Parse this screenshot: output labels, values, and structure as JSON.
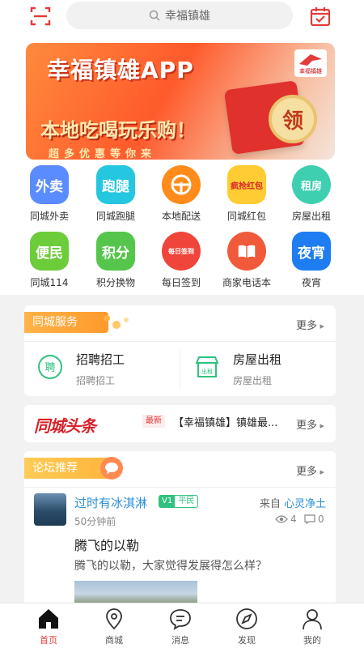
{
  "search": {
    "placeholder": "幸福镇雄"
  },
  "banner": {
    "title": "幸福镇雄APP",
    "subtitle": "本地吃喝玩乐购！",
    "tagline": "超多优惠等你来",
    "coin_text": "领",
    "logo_text": "幸福镇雄"
  },
  "grid": [
    {
      "icon_text": "外卖",
      "label": "同城外卖",
      "color": "#5b8cff"
    },
    {
      "icon_text": "跑腿",
      "label": "同城跑腿",
      "color": "#25c7e0"
    },
    {
      "icon_text": "",
      "label": "本地配送",
      "color": "#ff8c1a",
      "icon": "steering-wheel-icon"
    },
    {
      "icon_text": "疯抢红包",
      "label": "同城红包",
      "color": "#ffcc33",
      "icon": "red-packet-icon"
    },
    {
      "icon_text": "租房",
      "label": "房屋出租",
      "color": "#3ecfb0"
    },
    {
      "icon_text": "便民",
      "label": "同城114",
      "color": "#6dcc3a"
    },
    {
      "icon_text": "积分",
      "label": "积分换物",
      "color": "#55c64b"
    },
    {
      "icon_text": "每日签到",
      "label": "每日签到",
      "color": "#f0453a",
      "icon": "speedometer-icon"
    },
    {
      "icon_text": "",
      "label": "商家电话本",
      "color": "#f05a3a",
      "icon": "book-icon"
    },
    {
      "icon_text": "夜宵",
      "label": "夜宵",
      "color": "#1e7df0"
    }
  ],
  "services": {
    "tag": "同城服务",
    "more": "更多",
    "items": [
      {
        "title": "招聘招工",
        "sub": "招聘招工",
        "icon_text": "聘"
      },
      {
        "title": "房屋出租",
        "sub": "房屋出租",
        "icon_text": "出租"
      }
    ]
  },
  "news": {
    "logo": "同城头条",
    "badge": "最新",
    "text": "【幸福镇雄】镇雄最...",
    "more": "更多"
  },
  "forum": {
    "tag": "论坛推荐",
    "more": "更多",
    "post": {
      "author": "过时有冰淇淋",
      "level_v": "V1",
      "level": "平民",
      "time": "50分钟前",
      "from_label": "来自",
      "from_user": "心灵净土",
      "views": "4",
      "comments": "0",
      "title": "腾飞的以勒",
      "body": "腾飞的以勒，大家觉得发展得怎么样？"
    }
  },
  "nav": [
    {
      "label": "首页",
      "active": true
    },
    {
      "label": "商城",
      "active": false
    },
    {
      "label": "消息",
      "active": false
    },
    {
      "label": "发现",
      "active": false
    },
    {
      "label": "我的",
      "active": false
    }
  ],
  "colors": {
    "brand_red": "#e23b3b",
    "link_blue": "#2a8fd6",
    "level_green": "#2ec27e"
  }
}
